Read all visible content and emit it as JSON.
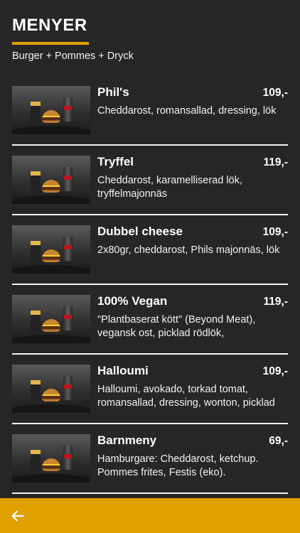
{
  "header": {
    "title": "MENYER"
  },
  "subtitle": "Burger + Pommes + Dryck",
  "items": [
    {
      "name": "Phil's",
      "price": "109,-",
      "description": "Cheddarost, romansallad, dressing, lök"
    },
    {
      "name": "Tryffel",
      "price": "119,-",
      "description": "Cheddarost, karamelliserad lök, tryffelmajonnäs"
    },
    {
      "name": "Dubbel cheese",
      "price": "109,-",
      "description": "2x80gr, cheddarost, Phils majonnäs, lök"
    },
    {
      "name": "100% Vegan",
      "price": "119,-",
      "description": "\"Plantbaserat kött\" (Beyond Meat), vegansk ost, picklad rödlök,"
    },
    {
      "name": "Halloumi",
      "price": "109,-",
      "description": "Halloumi, avokado, torkad tomat, romansallad, dressing, wonton, picklad"
    },
    {
      "name": "Barnmeny",
      "price": "69,-",
      "description": "Hamburgare: Cheddarost, ketchup. Pommes frites, Festis (eko)."
    }
  ],
  "footer": {
    "back_icon": "arrow-left-icon"
  },
  "colors": {
    "background": "#262626",
    "accent": "#e1a100",
    "text": "#ffffff"
  }
}
